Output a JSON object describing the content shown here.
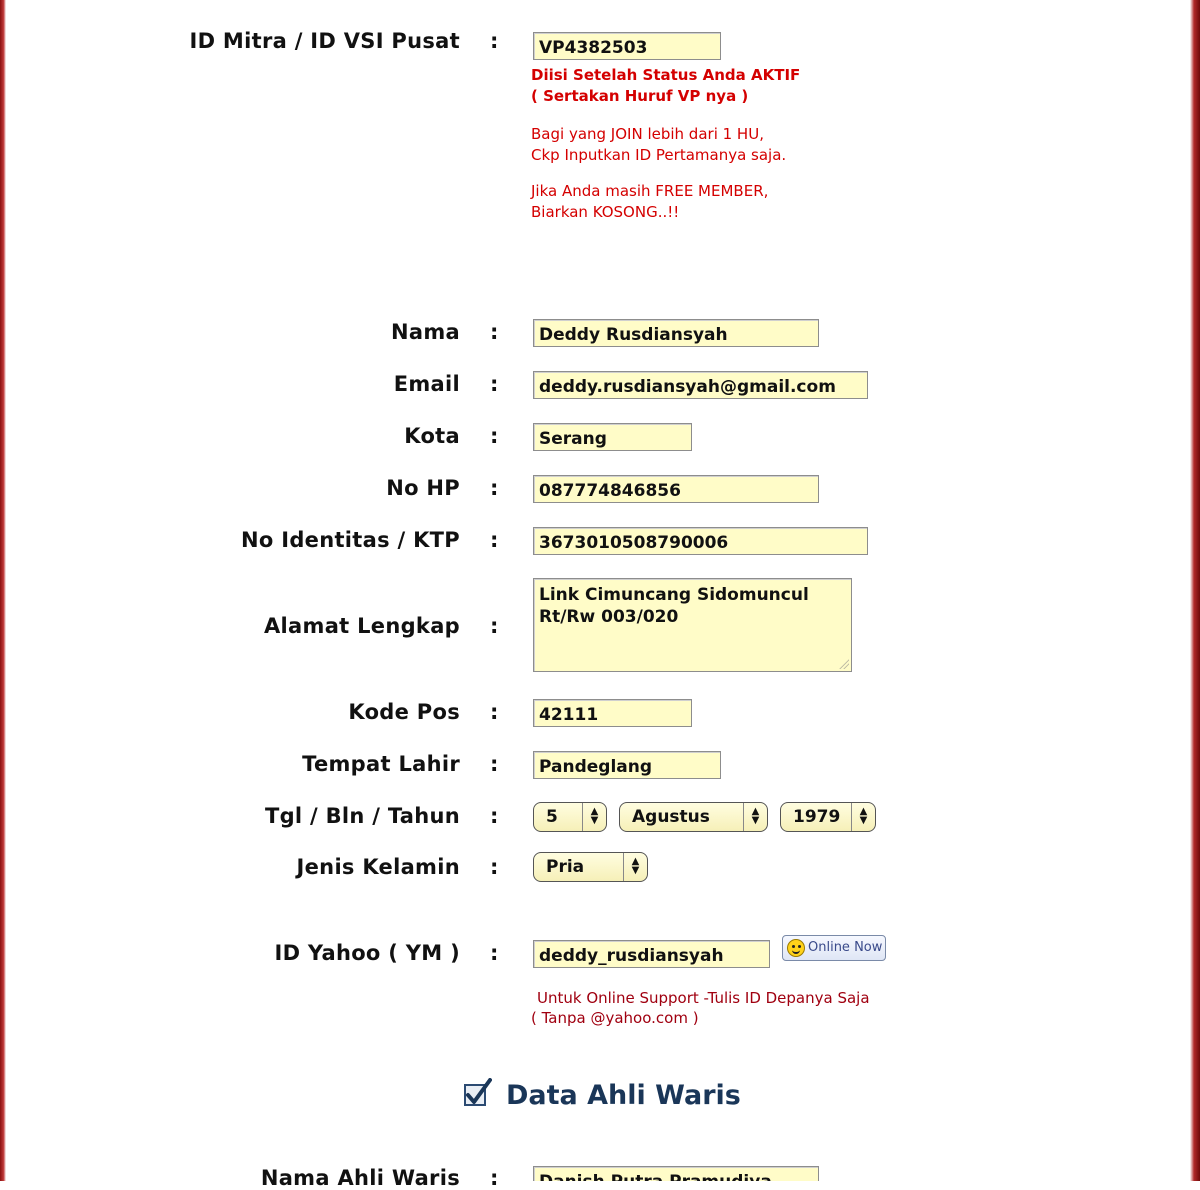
{
  "form": {
    "id_mitra": {
      "label": "ID Mitra / ID VSI Pusat",
      "value": "VP4382503",
      "note_1": "Diisi Setelah Status Anda AKTIF",
      "note_2": "( Sertakan Huruf VP nya )",
      "note_3": "Bagi yang JOIN lebih dari 1 HU,",
      "note_4": "Ckp Inputkan ID Pertamanya saja.",
      "note_5": "Jika Anda masih FREE MEMBER,",
      "note_6": "Biarkan KOSONG..!!"
    },
    "nama": {
      "label": "Nama",
      "value": "Deddy Rusdiansyah"
    },
    "email": {
      "label": "Email",
      "value": "deddy.rusdiansyah@gmail.com"
    },
    "kota": {
      "label": "Kota",
      "value": "Serang"
    },
    "no_hp": {
      "label": "No HP",
      "value": "087774846856"
    },
    "ktp": {
      "label": "No Identitas / KTP",
      "value": "3673010508790006"
    },
    "alamat": {
      "label": "Alamat Lengkap",
      "line_1": "Link Cimuncang Sidomuncul",
      "line_2": "Rt/Rw 003/020"
    },
    "kode_pos": {
      "label": "Kode Pos",
      "value": "42111"
    },
    "tempat_lahir": {
      "label": "Tempat Lahir",
      "value": "Pandeglang"
    },
    "tgl_lahir": {
      "label": "Tgl / Bln / Tahun",
      "day": "5",
      "month": "Agustus",
      "year": "1979"
    },
    "jenis_kelamin": {
      "label": "Jenis Kelamin",
      "value": "Pria"
    },
    "yahoo": {
      "label": "ID Yahoo ( YM )",
      "value": "deddy_rusdiansyah",
      "status_button": "Online Now",
      "note_1": "Untuk Online Support -Tulis ID Depanya Saja",
      "note_2": "( Tanpa @yahoo.com )"
    },
    "colon": ":"
  },
  "section": {
    "title": "Data Ahli Waris"
  },
  "ahli_waris": {
    "label": "Nama Ahli Waris",
    "value": "Danish Putra Pramudiya"
  }
}
